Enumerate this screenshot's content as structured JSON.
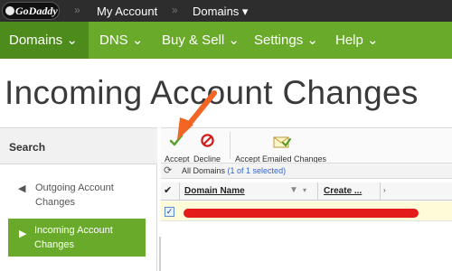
{
  "topbar": {
    "logo_text": "GoDaddy",
    "items": [
      {
        "label": "My Account"
      },
      {
        "label": "Domains ▾"
      }
    ]
  },
  "nav": {
    "items": [
      {
        "label": "Domains ⌄"
      },
      {
        "label": "DNS ⌄"
      },
      {
        "label": "Buy & Sell ⌄"
      },
      {
        "label": "Settings ⌄"
      },
      {
        "label": "Help ⌄"
      }
    ]
  },
  "page": {
    "title": "Incoming Account Changes"
  },
  "sidebar": {
    "title": "Search",
    "items": [
      {
        "label": "Outgoing Account Changes"
      },
      {
        "label": "Incoming Account Changes",
        "active": true
      }
    ]
  },
  "toolbar": {
    "accept_label": "Accept",
    "decline_label": "Decline",
    "accept_emailed_label": "Accept Emailed Changes"
  },
  "filterbar": {
    "all_domains": "All Domains",
    "selected_count": "(1 of 1 selected)"
  },
  "table": {
    "columns": [
      "Domain Name",
      "Create ..."
    ],
    "rows": [
      {
        "checked": true
      }
    ]
  },
  "colors": {
    "nav_green": "#6aaa2a",
    "nav_active": "#4e8b1d",
    "topbar": "#2d2d2d",
    "annotation_arrow": "#f26522",
    "redaction": "#e31b1b"
  }
}
